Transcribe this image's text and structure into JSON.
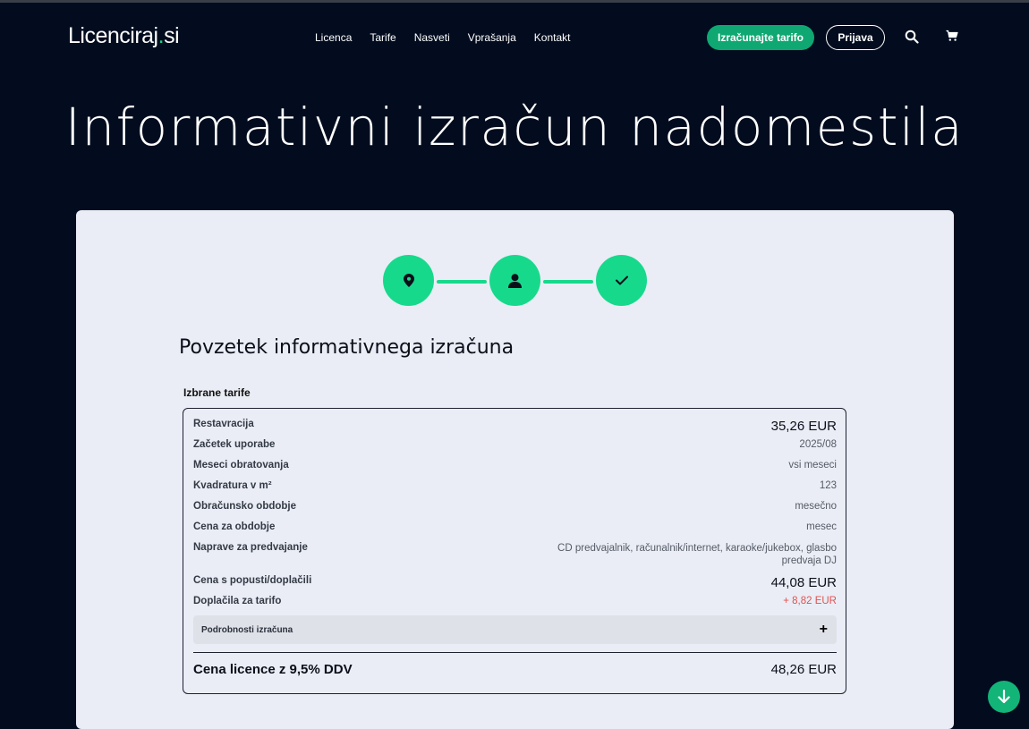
{
  "header": {
    "logo_main": "Licenciraj",
    "logo_dot": ".",
    "logo_tld": "si",
    "nav": [
      "Licenca",
      "Tarife",
      "Nasveti",
      "Vprašanja",
      "Kontakt"
    ],
    "calc_button": "Izračunajte tarifo",
    "login_button": "Prijava",
    "icons": [
      "search-icon",
      "cart-icon"
    ]
  },
  "hero": {
    "title": "Informativni izračun nadomestila"
  },
  "steps": {
    "icons": [
      "location-pin-icon",
      "user-icon",
      "check-icon"
    ],
    "accent_color": "#17d98c"
  },
  "summary": {
    "title": "Povzetek informativnega izračuna",
    "selected_label": "Izbrane tarife",
    "rows": [
      {
        "label": "Restavracija",
        "value": "35,26 EUR"
      },
      {
        "label": "Začetek uporabe",
        "value": "2025/08"
      },
      {
        "label": "Meseci obratovanja",
        "value": "vsi meseci"
      },
      {
        "label": "Kvadratura v m²",
        "value": "123"
      },
      {
        "label": "Obračunsko obdobje",
        "value": "mesečno"
      },
      {
        "label": "Cena za obdobje",
        "value": "mesec"
      },
      {
        "label": "Naprave za predvajanje",
        "value": "CD predvajalnik, računalnik/internet, karaoke/jukebox, glasbo predvaja DJ"
      },
      {
        "label": "Cena s popusti/doplačili",
        "value": "44,08 EUR"
      },
      {
        "label": "Doplačila za tarifo",
        "value": "+ 8,82 EUR"
      }
    ],
    "details_label": "Podrobnosti izračuna",
    "details_toggle": "+",
    "total_label": "Cena licence z 9,5% DDV",
    "total_value": "48,26 EUR"
  },
  "colors": {
    "background": "#020c1e",
    "accent": "#17d98c",
    "button": "#0fa872",
    "surcharge": "#e05252"
  }
}
